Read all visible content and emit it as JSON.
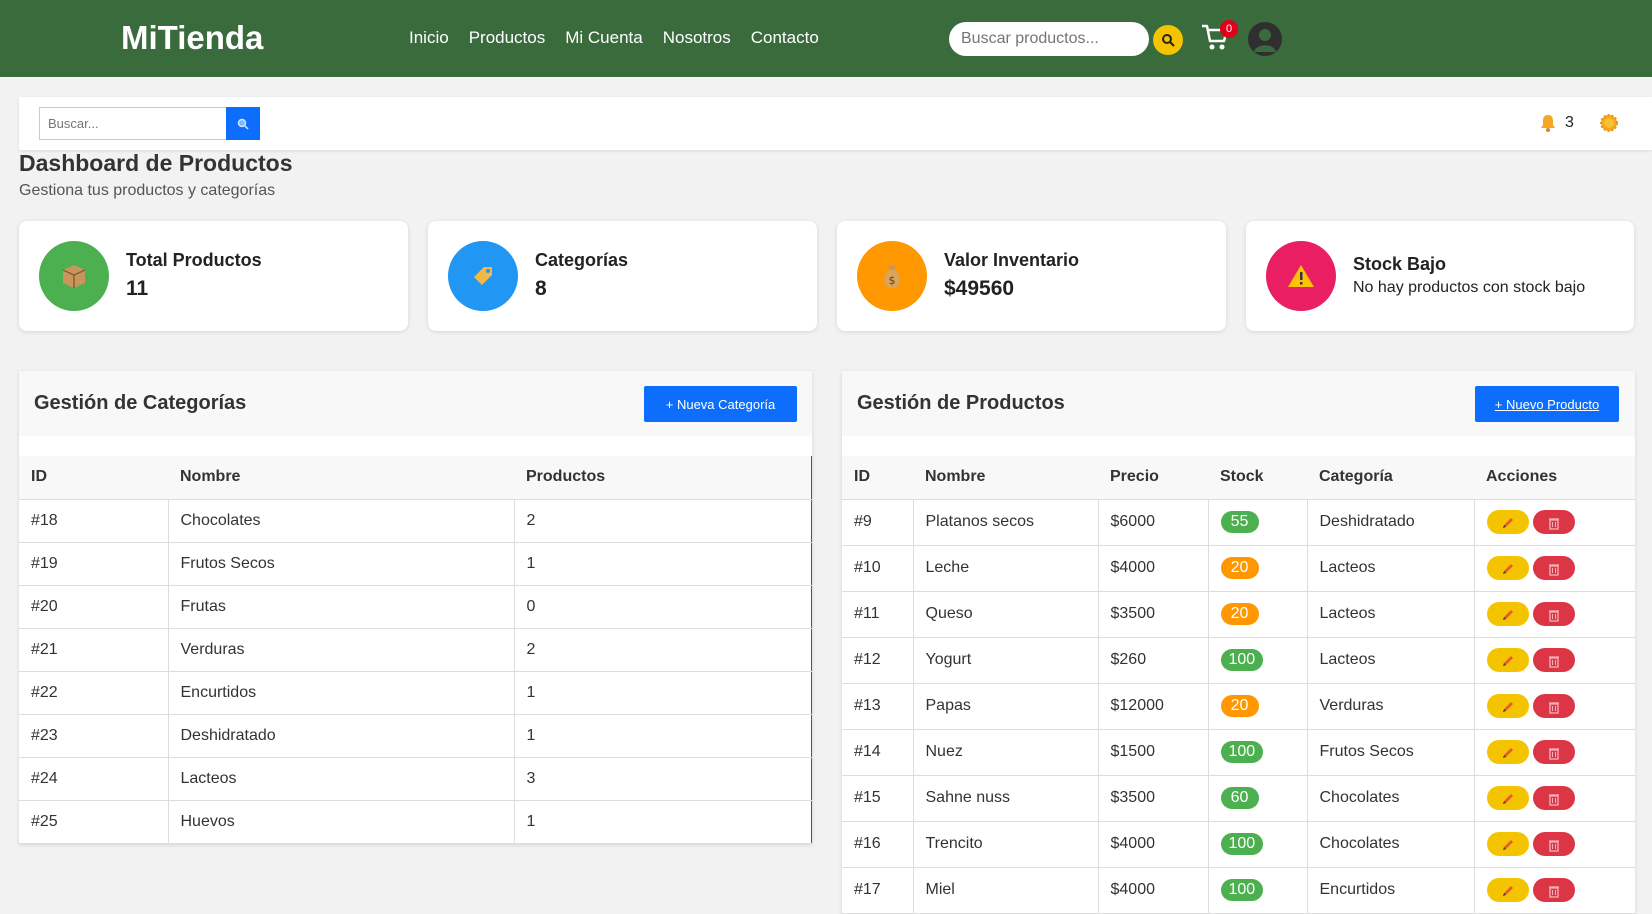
{
  "nav": {
    "brand": "MiTienda",
    "links": [
      "Inicio",
      "Productos",
      "Mi Cuenta",
      "Nosotros",
      "Contacto"
    ],
    "search_placeholder": "Buscar productos...",
    "cart_count": "0"
  },
  "toolbar": {
    "search_placeholder": "Buscar...",
    "notifications_count": "3"
  },
  "page": {
    "title": "Dashboard de Productos",
    "subtitle": "Gestiona tus productos y categorías"
  },
  "stats": [
    {
      "label": "Total Productos",
      "value": "11",
      "icon": "box-icon",
      "color": "#4caf50"
    },
    {
      "label": "Categorías",
      "value": "8",
      "icon": "tag-icon",
      "color": "#2196f3"
    },
    {
      "label": "Valor Inventario",
      "value": "$49560",
      "icon": "money-bag-icon",
      "color": "#ff9800"
    },
    {
      "label": "Stock Bajo",
      "value": "No hay productos con stock bajo",
      "icon": "warning-icon",
      "color": "#e91e63"
    }
  ],
  "categories": {
    "title": "Gestión de Categorías",
    "button": "+ Nueva Categoría",
    "headers": [
      "ID",
      "Nombre",
      "Productos"
    ],
    "rows": [
      [
        "#18",
        "Chocolates",
        "2"
      ],
      [
        "#19",
        "Frutos Secos",
        "1"
      ],
      [
        "#20",
        "Frutas",
        "0"
      ],
      [
        "#21",
        "Verduras",
        "2"
      ],
      [
        "#22",
        "Encurtidos",
        "1"
      ],
      [
        "#23",
        "Deshidratado",
        "1"
      ],
      [
        "#24",
        "Lacteos",
        "3"
      ],
      [
        "#25",
        "Huevos",
        "1"
      ]
    ]
  },
  "products": {
    "title": "Gestión de Productos",
    "button": "+ Nuevo Producto",
    "headers": [
      "ID",
      "Nombre",
      "Precio",
      "Stock",
      "Categoría",
      "Acciones"
    ],
    "rows": [
      {
        "id": "#9",
        "name": "Platanos secos",
        "price": "$6000",
        "stock": "55",
        "stock_color": "#4caf50",
        "category": "Deshidratado"
      },
      {
        "id": "#10",
        "name": "Leche",
        "price": "$4000",
        "stock": "20",
        "stock_color": "#ff9800",
        "category": "Lacteos"
      },
      {
        "id": "#11",
        "name": "Queso",
        "price": "$3500",
        "stock": "20",
        "stock_color": "#ff9800",
        "category": "Lacteos"
      },
      {
        "id": "#12",
        "name": "Yogurt",
        "price": "$260",
        "stock": "100",
        "stock_color": "#4caf50",
        "category": "Lacteos"
      },
      {
        "id": "#13",
        "name": "Papas",
        "price": "$12000",
        "stock": "20",
        "stock_color": "#ff9800",
        "category": "Verduras"
      },
      {
        "id": "#14",
        "name": "Nuez",
        "price": "$1500",
        "stock": "100",
        "stock_color": "#4caf50",
        "category": "Frutos Secos"
      },
      {
        "id": "#15",
        "name": "Sahne nuss",
        "price": "$3500",
        "stock": "60",
        "stock_color": "#4caf50",
        "category": "Chocolates"
      },
      {
        "id": "#16",
        "name": "Trencito",
        "price": "$4000",
        "stock": "100",
        "stock_color": "#4caf50",
        "category": "Chocolates"
      },
      {
        "id": "#17",
        "name": "Miel",
        "price": "$4000",
        "stock": "100",
        "stock_color": "#4caf50",
        "category": "Encurtidos"
      }
    ]
  }
}
